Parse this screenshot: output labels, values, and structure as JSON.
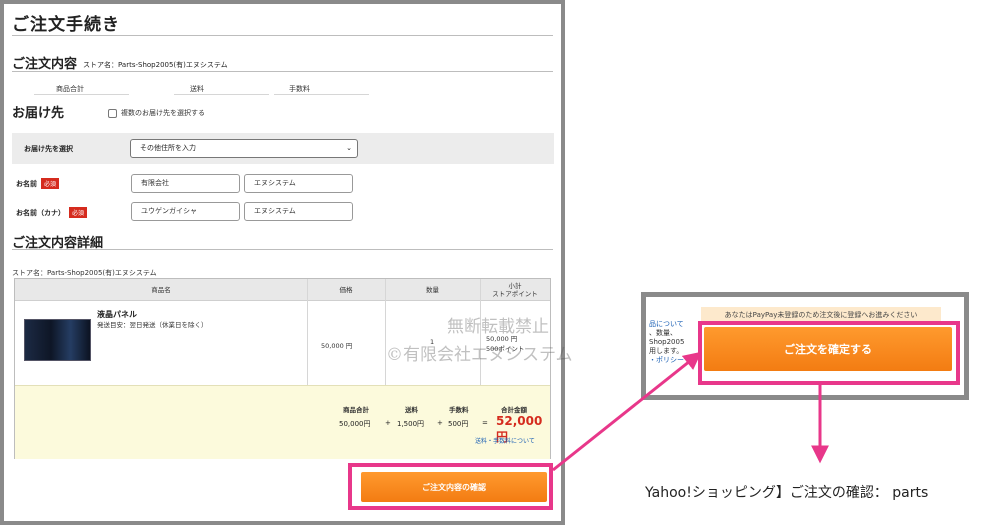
{
  "left_panel": {
    "title": "ご注文手続き",
    "order_contents": {
      "heading": "ご注文内容",
      "store": "ストア名：Parts-Shop2005(有)エヌシステム",
      "summary_labels": [
        "商品合計",
        "送料",
        "手数料"
      ]
    },
    "delivery": {
      "heading": "お届け先",
      "multi_address_label": "複数のお届け先を選択する",
      "select_label": "お届け先を選択",
      "select_value": "その他住所を入力",
      "name_label": "お名前",
      "name_kana_label": "お名前（カナ）",
      "required_badge": "必須",
      "last_name": "有限会社",
      "first_name": "エヌシステム",
      "last_name_kana": "ユウゲンガイシャ",
      "first_name_kana": "エヌシステム"
    },
    "details": {
      "heading": "ご注文内容詳細",
      "store": "ストア名：Parts-Shop2005(有)エヌシステム",
      "columns": {
        "product": "商品名",
        "price": "価格",
        "qty": "数量",
        "subtotal": "小計\nストアポイント"
      },
      "item": {
        "name": "液晶パネル",
        "shipping": "発送目安：翌日発送（休業日を除く）",
        "price": "50,000 円",
        "qty": "1",
        "subtotal": "50,000 円",
        "points": "500ポイント"
      },
      "totals": {
        "labels": [
          "商品合計",
          "送料",
          "手数料",
          "合計金額"
        ],
        "products": "50,000円",
        "shipping": "1,500円",
        "fee": "500円",
        "plus": "+",
        "equals": "=",
        "grand_total": "52,000円",
        "fee_link": "送料・手数料について"
      }
    },
    "confirm_button": "ご注文内容の確認"
  },
  "watermark": {
    "line1": "無断転載禁止",
    "line2": "©有限会社エヌシステム"
  },
  "right_panel": {
    "notice": "あなたはPayPay未登録のため注文後に登録へお進みください",
    "side_lines": [
      "品について",
      "、数量、",
      "Shop2005",
      "用します。",
      "・ポリシー"
    ],
    "place_order_button": "ご注文を確定する"
  },
  "caption": "Yahoo!ショッピング】ご注文の確認： parts",
  "colors": {
    "accent_orange": "#f5841f",
    "highlight_pink": "#e8378a",
    "required_red": "#d52b1e",
    "total_red": "#d52b1e",
    "frame_gray": "#8a8a8a"
  }
}
